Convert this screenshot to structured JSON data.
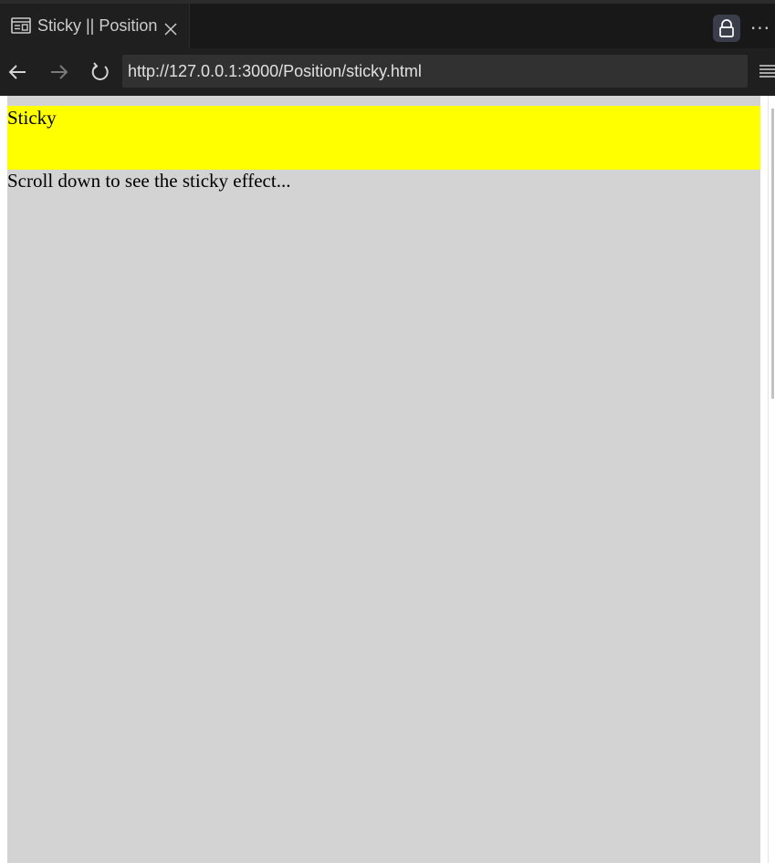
{
  "tab": {
    "title": "Sticky || Position",
    "icon": "preview-icon",
    "close_icon": "close-icon"
  },
  "titlebar": {
    "lock_icon": "lock-icon",
    "more_label": "···"
  },
  "toolbar": {
    "back_icon": "arrow-left-icon",
    "forward_icon": "arrow-right-icon",
    "reload_icon": "reload-icon",
    "url": "http://127.0.0.1:3000/Position/sticky.html",
    "menu_icon": "menu-icon"
  },
  "page": {
    "sticky_text": "Sticky",
    "body_text": "Scroll down to see the sticky effect...",
    "sticky_color": "#ffff00",
    "content_color": "#d3d3d3"
  }
}
